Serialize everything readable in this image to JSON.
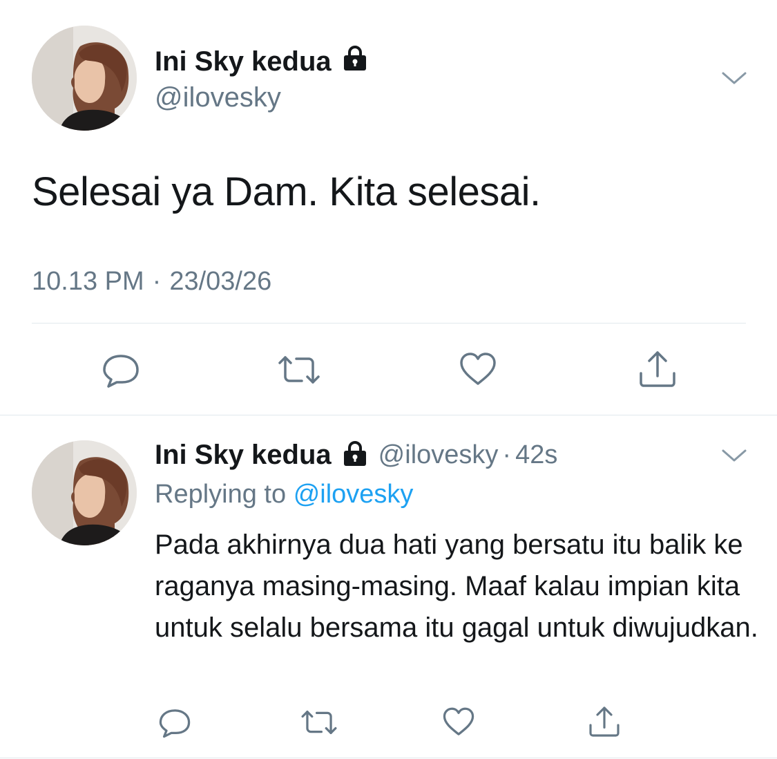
{
  "main_tweet": {
    "display_name": "Ini Sky kedua",
    "handle": "@ilovesky",
    "text": "Selesai ya Dam. Kita selesai.",
    "time": "10.13 PM",
    "separator": "·",
    "date": "23/03/26",
    "actions": [
      "reply-icon",
      "retweet-icon",
      "like-icon",
      "share-icon"
    ]
  },
  "reply_tweet": {
    "display_name": "Ini Sky kedua",
    "handle": "@ilovesky",
    "separator": "·",
    "age": "42s",
    "replying_prefix": "Replying to",
    "replying_handle": "@ilovesky",
    "text": "Pada akhirnya dua hati yang bersatu itu balik ke raganya masing-masing. Maaf kalau impian kita untuk selalu bersama itu gagal untuk diwujudkan.",
    "actions": [
      "reply-icon",
      "retweet-icon",
      "like-icon",
      "share-icon"
    ]
  },
  "colors": {
    "text": "#14171a",
    "secondary": "#657786",
    "link": "#1da1f2",
    "divider": "#e1e8ed"
  }
}
